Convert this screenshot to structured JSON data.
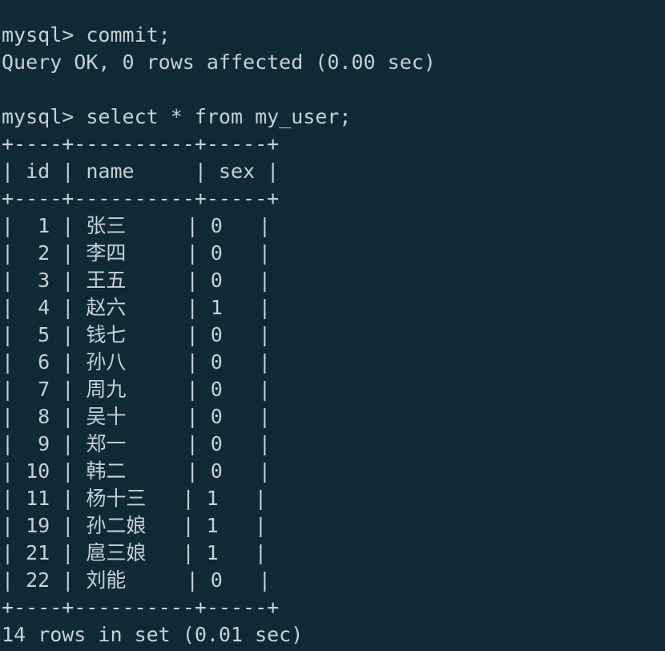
{
  "terminal": {
    "lines": [
      "mysql> commit;",
      "Query OK, 0 rows affected (0.00 sec)",
      "",
      "mysql> select * from my_user;",
      "+----+----------+-----+",
      "| id | name     | sex |",
      "+----+----------+-----+",
      "|  1 | 张三     | 0   |",
      "|  2 | 李四     | 0   |",
      "|  3 | 王五     | 0   |",
      "|  4 | 赵六     | 1   |",
      "|  5 | 钱七     | 0   |",
      "|  6 | 孙八     | 0   |",
      "|  7 | 周九     | 0   |",
      "|  8 | 吴十     | 0   |",
      "|  9 | 郑一     | 0   |",
      "| 10 | 韩二     | 0   |",
      "| 11 | 杨十三   | 1   |",
      "| 19 | 孙二娘   | 1   |",
      "| 21 | 扈三娘   | 1   |",
      "| 22 | 刘能     | 0   |",
      "+----+----------+-----+",
      "14 rows in set (0.01 sec)"
    ]
  }
}
